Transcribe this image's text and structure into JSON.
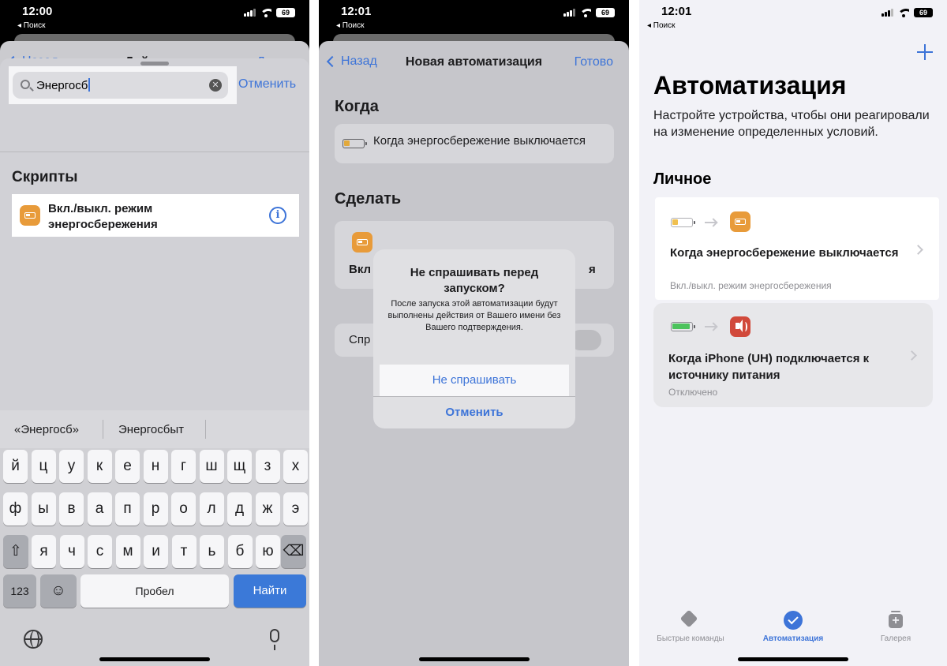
{
  "panel1": {
    "status": {
      "time": "12:00",
      "back_app": "◂ Поиск",
      "battery": "69"
    },
    "nav": {
      "back": "Назад",
      "title": "Действия",
      "next": "Далее"
    },
    "search": {
      "value": "Энергосб",
      "cancel": "Отменить"
    },
    "section": "Скрипты",
    "result": {
      "label": "Вкл./выкл. режим энергосбережения",
      "icon": "battery-icon"
    },
    "keyboard": {
      "suggestions": [
        "«Энергосб»",
        "Энергосбыт"
      ],
      "row1": [
        "й",
        "ц",
        "у",
        "к",
        "е",
        "н",
        "г",
        "ш",
        "щ",
        "з",
        "х"
      ],
      "row2": [
        "ф",
        "ы",
        "в",
        "а",
        "п",
        "р",
        "о",
        "л",
        "д",
        "ж",
        "э"
      ],
      "row3": [
        "я",
        "ч",
        "с",
        "м",
        "и",
        "т",
        "ь",
        "б",
        "ю"
      ],
      "shift": "⇧",
      "backspace": "⌫",
      "numbers": "123",
      "emoji": "☺",
      "space": "Пробел",
      "go": "Найти"
    }
  },
  "panel2": {
    "status": {
      "time": "12:01",
      "back_app": "◂ Поиск",
      "battery": "69"
    },
    "nav": {
      "back": "Назад",
      "title": "Новая автоматизация",
      "done": "Готово"
    },
    "when_section": "Когда",
    "when_value": "Когда энергосбережение выключается",
    "do_section": "Сделать",
    "do_partial_left": "Вкл",
    "do_partial_right": "я",
    "ask_partial": "Спр",
    "alert": {
      "title": "Не спрашивать перед запуском?",
      "message": "После запуска этой автоматизации будут выполнены действия от Вашего имени без Вашего подтверждения.",
      "confirm": "Не спрашивать",
      "cancel": "Отменить"
    }
  },
  "panel3": {
    "status": {
      "time": "12:01",
      "back_app": "◂ Поиск",
      "battery": "69"
    },
    "title": "Автоматизация",
    "subtitle": "Настройте устройства, чтобы они реагировали на изменение определенных условий.",
    "section": "Личное",
    "cards": [
      {
        "title": "Когда энергосбережение выключается",
        "subtitle": "Вкл./выкл. режим энергосбережения"
      },
      {
        "title": "Когда iPhone (UH) подключается к источнику питания",
        "subtitle": "Отключено"
      }
    ],
    "tabs": [
      {
        "label": "Быстрые команды",
        "icon": "layers-icon"
      },
      {
        "label": "Автоматизация",
        "icon": "clock-icon"
      },
      {
        "label": "Галерея",
        "icon": "gallery-icon"
      }
    ]
  },
  "colors": {
    "accent": "#3d74d8",
    "app_orange": "#e89b3a",
    "sound_red": "#d1493b"
  }
}
